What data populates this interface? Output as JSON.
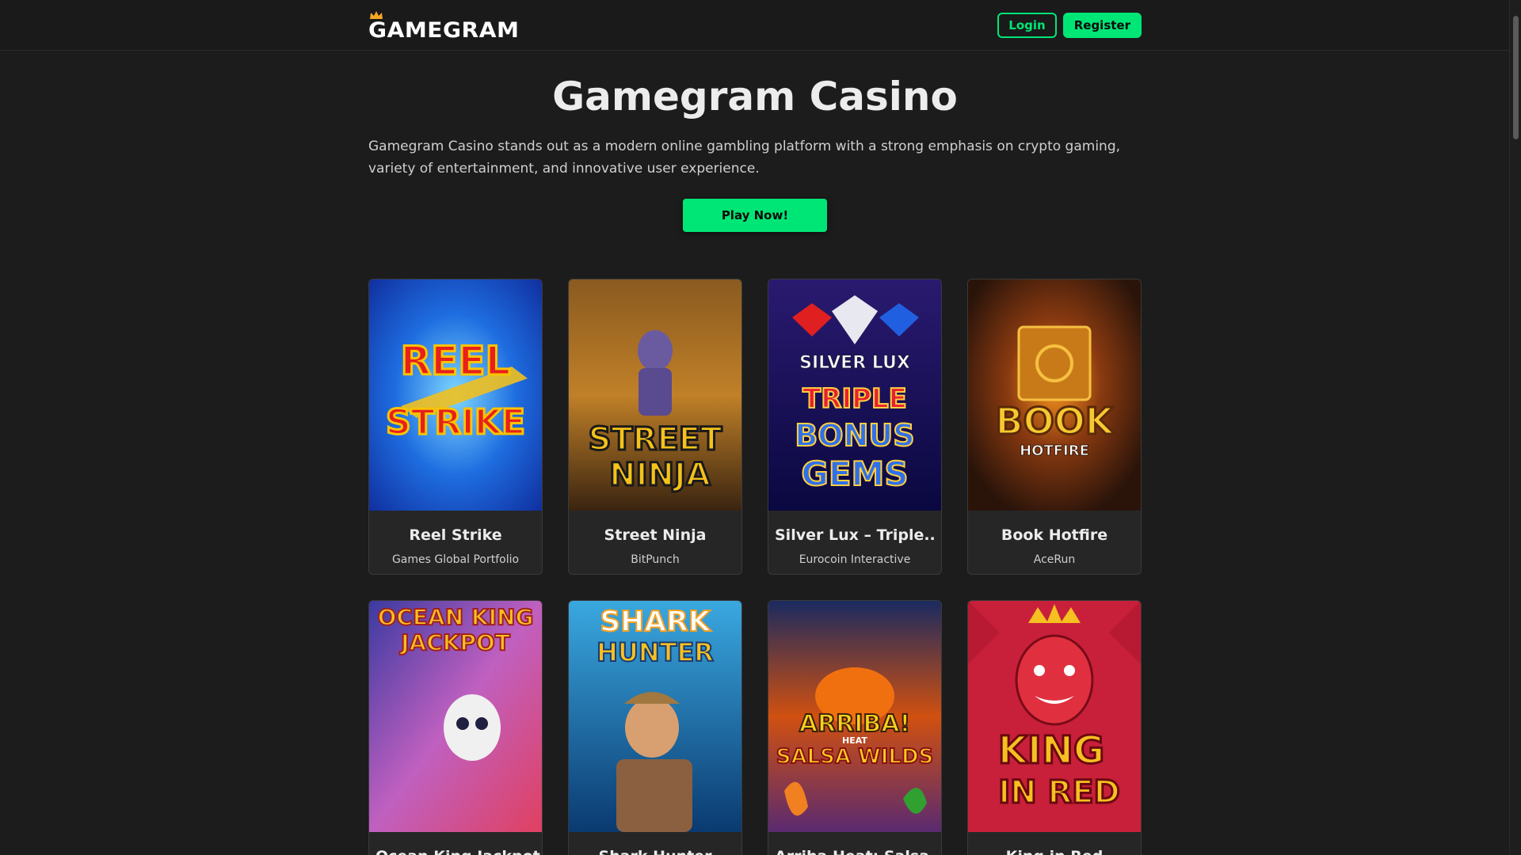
{
  "header": {
    "logo_text": "GAMEGRAM",
    "login_label": "Login",
    "register_label": "Register"
  },
  "hero": {
    "title": "Gamegram Casino",
    "description": "Gamegram Casino stands out as a modern online gambling platform with a strong emphasis on crypto gaming, variety of entertainment, and innovative user experience.",
    "cta_label": "Play Now!"
  },
  "games": [
    {
      "title": "Reel Strike",
      "provider": "Games Global Portfolio",
      "art": [
        "REEL",
        "STRIKE"
      ]
    },
    {
      "title": "Street Ninja",
      "provider": "BitPunch",
      "art": [
        "STREET",
        "NINJA"
      ]
    },
    {
      "title": "Silver Lux – Triple..",
      "provider": "Eurocoin Interactive",
      "art": [
        "SILVER LUX",
        "TRIPLE",
        "BONUS",
        "GEMS"
      ]
    },
    {
      "title": "Book Hotfire",
      "provider": "AceRun",
      "art": [
        "BOOK",
        "HOTFIRE"
      ]
    },
    {
      "title": "Ocean King Jackpot",
      "provider": "",
      "art": [
        "OCEAN KING",
        "JACKPOT"
      ]
    },
    {
      "title": "Shark Hunter",
      "provider": "",
      "art": [
        "SHARK",
        "HUNTER"
      ]
    },
    {
      "title": "Arriba Heat: Salsa..",
      "provider": "",
      "art": [
        "ARRIBA!",
        "HEAT",
        "SALSA WILDS"
      ]
    },
    {
      "title": "King in Red",
      "provider": "",
      "art": [
        "KING",
        "IN RED"
      ]
    }
  ],
  "colors": {
    "accent": "#00e676",
    "background": "#1c1c1c",
    "card": "#262626"
  }
}
